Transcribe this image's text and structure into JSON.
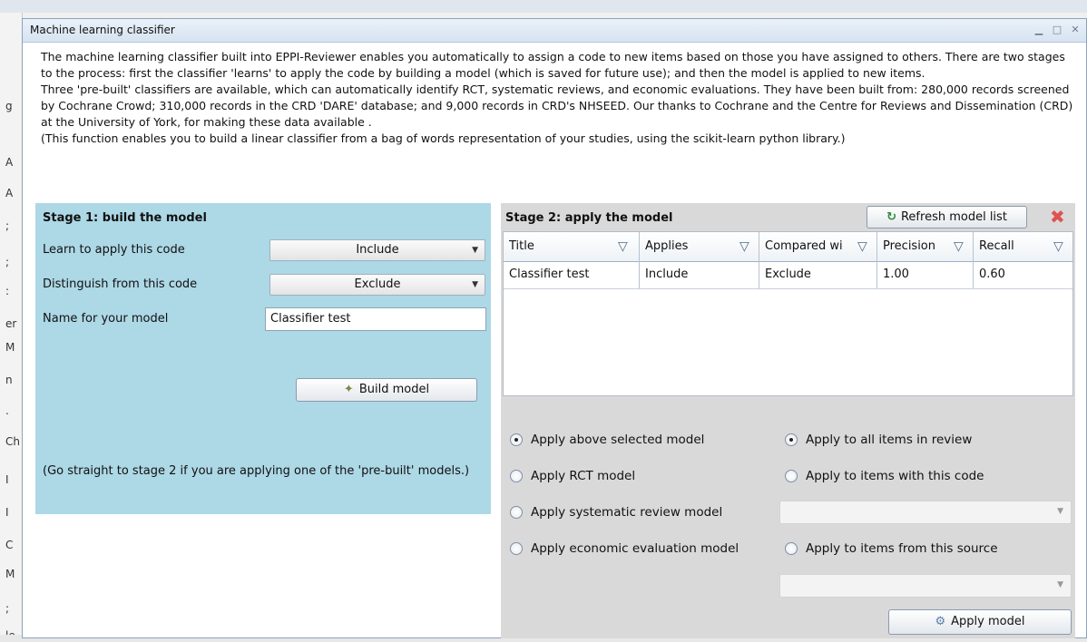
{
  "dialog": {
    "title": "Machine learning classifier"
  },
  "intro": {
    "paragraphs": [
      "The machine learning classifier built into EPPI-Reviewer enables you automatically to assign a code to new items based on those you have assigned to others. There are two stages to the process: first the classifier 'learns' to apply the code by building a model (which is saved for future use); and then the model is applied to new items.",
      "Three 'pre-built' classifiers are available, which can automatically identify RCT, systematic reviews, and economic evaluations. They have been built from: 280,000 records screened by Cochrane Crowd; 310,000 records in the CRD 'DARE' database; and 9,000 records in CRD's NHSEED. Our thanks to Cochrane and the Centre for Reviews and Dissemination (CRD) at the University of York, for making these data available .",
      "(This function enables you to build a linear classifier from a bag of words representation of your studies, using the scikit-learn python library.)"
    ]
  },
  "stage1": {
    "heading": "Stage 1: build the model",
    "learn_label": "Learn to apply this code",
    "learn_value": "Include",
    "distinguish_label": "Distinguish from this code",
    "distinguish_value": "Exclude",
    "name_label": "Name for your model",
    "name_value": "Classifier test",
    "build_button": "Build model",
    "note": "(Go straight to stage 2 if you are applying one of the 'pre-built' models.)"
  },
  "stage2": {
    "heading": "Stage 2: apply the model",
    "refresh_button": "Refresh model list",
    "columns": [
      "Title",
      "Applies",
      "Compared wi",
      "Precision",
      "Recall"
    ],
    "rows": [
      [
        "Classifier test",
        "Include",
        "Exclude",
        "1.00",
        "0.60"
      ]
    ],
    "model_options": [
      {
        "label": "Apply above selected model",
        "selected": true
      },
      {
        "label": "Apply RCT model",
        "selected": false
      },
      {
        "label": "Apply systematic review model",
        "selected": false
      },
      {
        "label": "Apply economic evaluation model",
        "selected": false
      }
    ],
    "scope_options": [
      {
        "label": "Apply to all items in review",
        "selected": true
      },
      {
        "label": "Apply to items with this code",
        "selected": false
      },
      {
        "label": "Apply to items from this source",
        "selected": false
      }
    ],
    "apply_button": "Apply model"
  },
  "background_letters": [
    "g",
    "A",
    "A",
    ";",
    ";",
    ":",
    "er",
    "M",
    "n",
    ".",
    "Ch",
    "I",
    "I",
    "C",
    "M",
    ";",
    "le"
  ],
  "colors": {
    "stage1_bg": "#add8e6",
    "stage2_bg": "#d9d9d9",
    "titlebar": "#d7e3f1",
    "delete_icon": "#e05252",
    "refresh_icon": "#2e8b3a"
  }
}
